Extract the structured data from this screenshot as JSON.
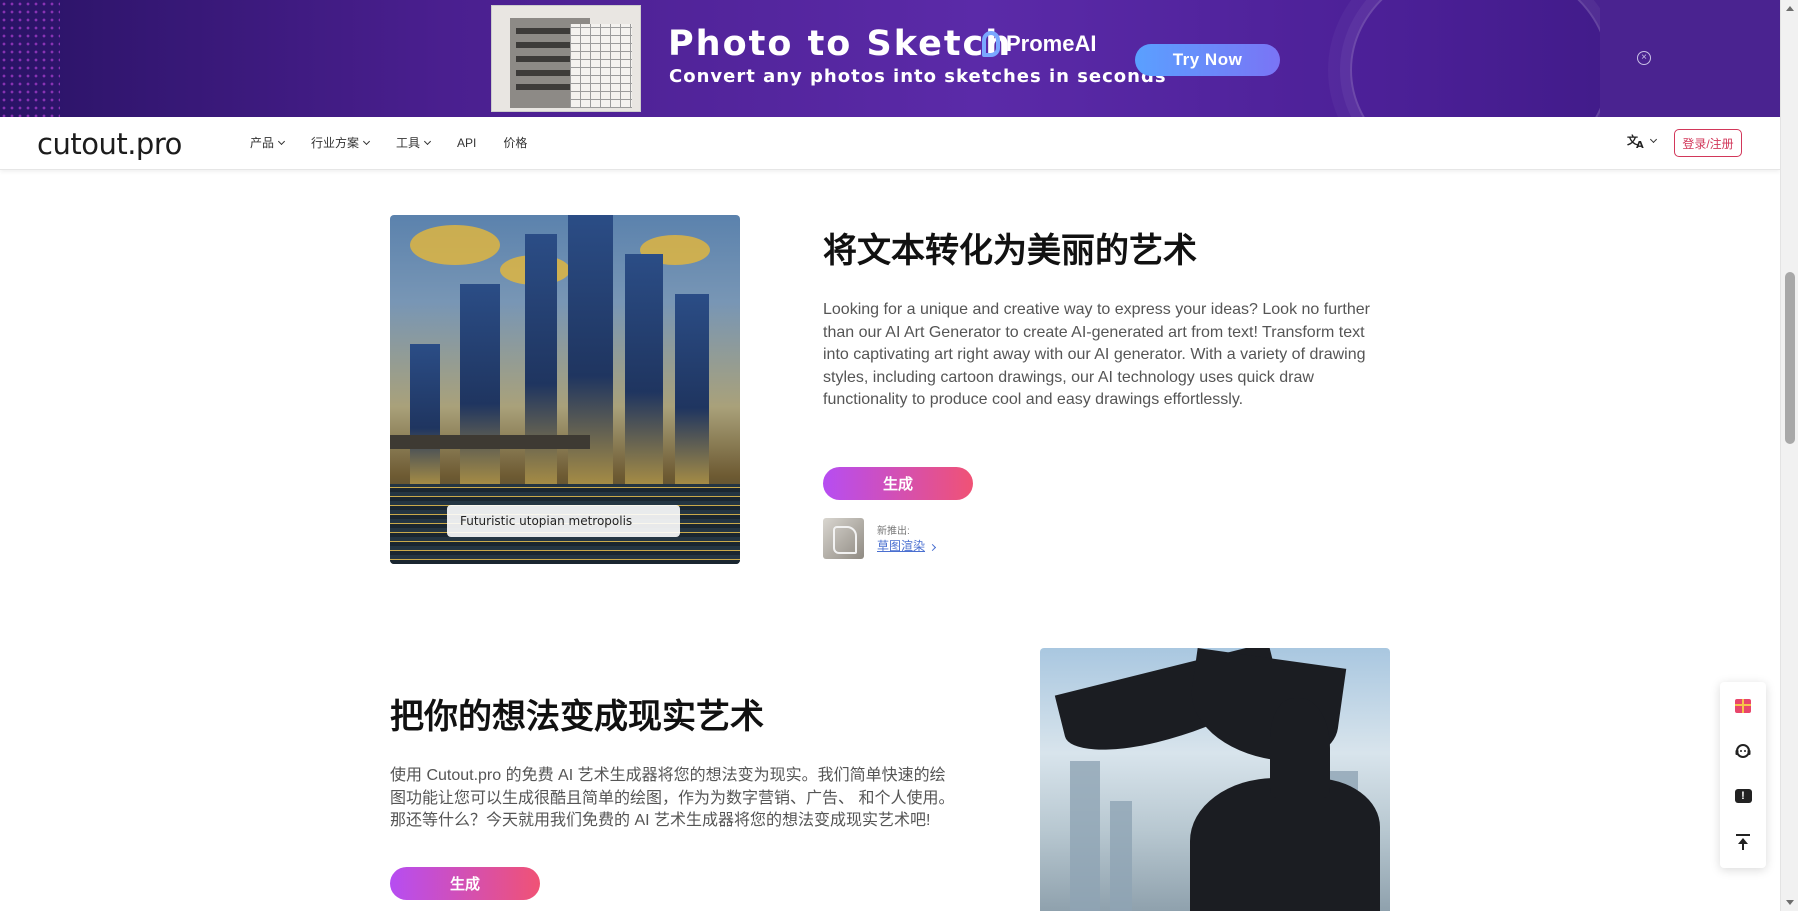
{
  "ad": {
    "title": "Photo to Sketch",
    "subtitle": "Convert any photos into sketches in seconds",
    "brand": "PromeAI",
    "cta_label": "Try Now",
    "close_symbol": "×"
  },
  "nav": {
    "logo": "cutout.pro",
    "items": [
      {
        "label": "产品",
        "dropdown": true
      },
      {
        "label": "行业方案",
        "dropdown": true
      },
      {
        "label": "工具",
        "dropdown": true
      },
      {
        "label": "API",
        "dropdown": false
      },
      {
        "label": "价格",
        "dropdown": false
      }
    ],
    "language_icon": "translate-icon",
    "login_label": "登录/注册"
  },
  "section1": {
    "image_caption": "Futuristic utopian metropolis",
    "title": "将文本转化为美丽的艺术",
    "body": "Looking for a unique and creative way to express your ideas? Look no further than our AI Art Generator to create AI-generated art from text! Transform text into captivating art right away with our AI generator. With a variety of drawing styles, including cartoon drawings, our AI technology uses quick draw functionality to produce cool and easy drawings effortlessly.",
    "button_label": "生成",
    "new_release_label": "新推出:",
    "new_release_link": "草图渲染"
  },
  "section2": {
    "title": "把你的想法变成现实艺术",
    "body": "使用 Cutout.pro 的免费 AI 艺术生成器将您的想法变为现实。我们简单快速的绘图功能让您可以生成很酷且简单的绘图，作为为数字营销、广告、 和个人使用。那还等什么？今天就用我们免费的 AI 艺术生成器将您的想法变成现实艺术吧!",
    "button_label": "生成"
  },
  "floating_toolbar": {
    "items": [
      "gift-icon",
      "support-agent-icon",
      "feedback-icon",
      "back-to-top-icon"
    ],
    "feedback_symbol": "!"
  },
  "colors": {
    "accent_gradient_start": "#b64df2",
    "accent_gradient_end": "#f05275",
    "login_red": "#d2375a",
    "ad_background": "#4a1f8f"
  }
}
